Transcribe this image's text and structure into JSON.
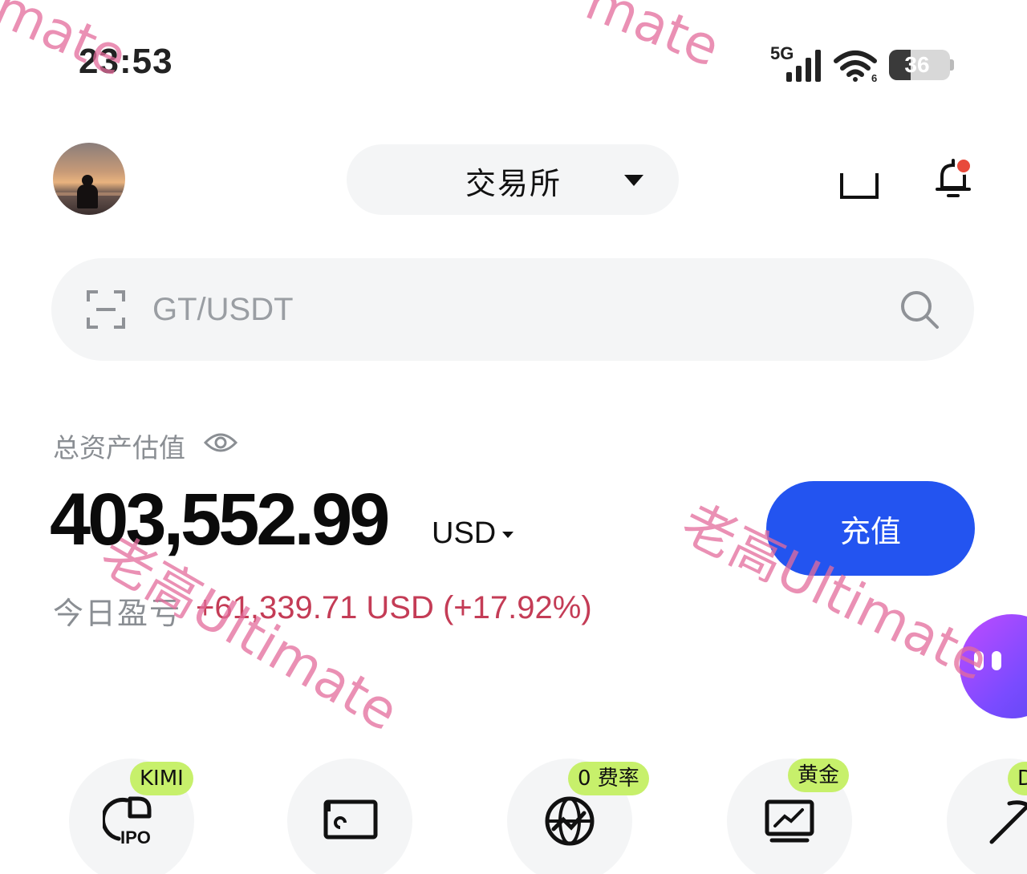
{
  "status_bar": {
    "time": "23:53",
    "network": "5G",
    "battery": "36",
    "battery_level": 0.36
  },
  "header": {
    "exchange_label": "交易所"
  },
  "search": {
    "placeholder": "GT/USDT"
  },
  "assets": {
    "label": "总资产估值",
    "total": "403,552.99",
    "currency": "USD",
    "deposit_label": "充值",
    "pnl_label": "今日盈亏",
    "pnl_value": "+61,339.71 USD (+17.92%)"
  },
  "quick_actions": [
    {
      "tag": "KIMI",
      "icon": "ipo-icon",
      "icon_text": "IPO"
    },
    {
      "tag": "",
      "icon": "screen-icon"
    },
    {
      "tag": "0 费率",
      "icon": "globe-icon"
    },
    {
      "tag": "黄金",
      "icon": "chart-icon"
    },
    {
      "tag": "D",
      "icon": "pickaxe-icon"
    }
  ],
  "watermark": {
    "text": "老高Ultimate",
    "partial_text": "mate",
    "color": "#e36c9b"
  },
  "colors": {
    "accent": "#2354f0",
    "loss_red": "#c43c56",
    "tag_green": "#c7f06b",
    "notification": "#e84a3b"
  }
}
